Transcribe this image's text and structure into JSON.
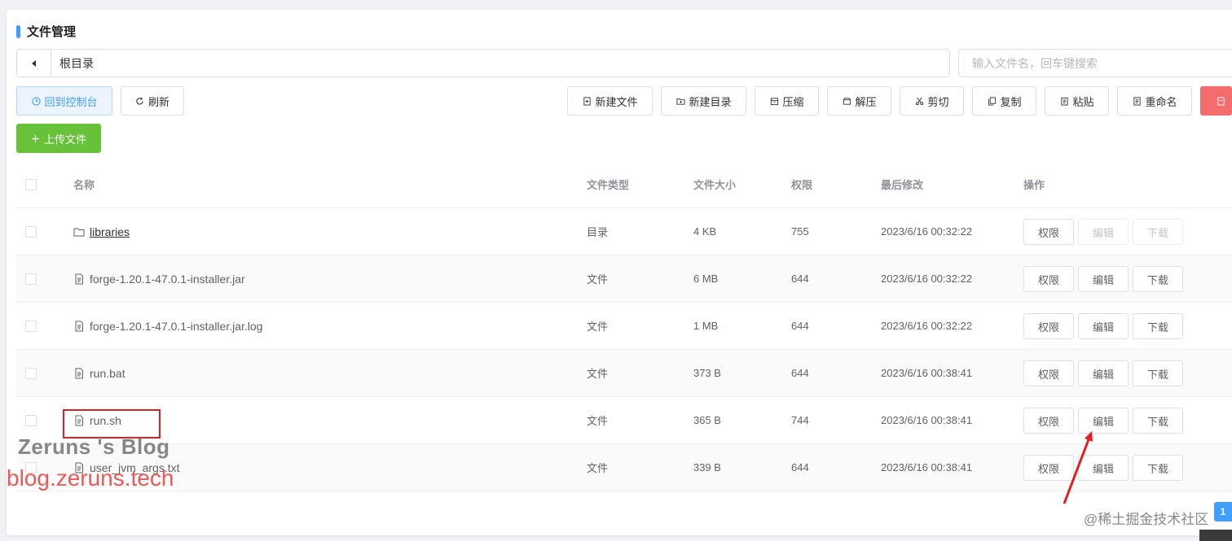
{
  "title": "文件管理",
  "path": {
    "current": "根目录"
  },
  "search": {
    "placeholder": "输入文件名，回车键搜索"
  },
  "toolbar": {
    "back_console": "回到控制台",
    "refresh": "刷新",
    "new_file": "新建文件",
    "new_dir": "新建目录",
    "compress": "压缩",
    "extract": "解压",
    "cut": "剪切",
    "copy": "复制",
    "paste": "粘贴",
    "rename": "重命名",
    "upload": "上传文件"
  },
  "table": {
    "headers": {
      "name": "名称",
      "type": "文件类型",
      "size": "文件大小",
      "perm": "权限",
      "modified": "最后修改",
      "actions": "操作"
    },
    "rows": [
      {
        "name": "libraries",
        "type": "目录",
        "size": "4 KB",
        "perm": "755",
        "modified": "2023/6/16 00:32:22",
        "kind": "folder"
      },
      {
        "name": "forge-1.20.1-47.0.1-installer.jar",
        "type": "文件",
        "size": "6 MB",
        "perm": "644",
        "modified": "2023/6/16 00:32:22",
        "kind": "file"
      },
      {
        "name": "forge-1.20.1-47.0.1-installer.jar.log",
        "type": "文件",
        "size": "1 MB",
        "perm": "644",
        "modified": "2023/6/16 00:32:22",
        "kind": "file"
      },
      {
        "name": "run.bat",
        "type": "文件",
        "size": "373 B",
        "perm": "644",
        "modified": "2023/6/16 00:38:41",
        "kind": "file"
      },
      {
        "name": "run.sh",
        "type": "文件",
        "size": "365 B",
        "perm": "744",
        "modified": "2023/6/16 00:38:41",
        "kind": "file"
      },
      {
        "name": "user_jvm_args.txt",
        "type": "文件",
        "size": "339 B",
        "perm": "644",
        "modified": "2023/6/16 00:38:41",
        "kind": "file"
      }
    ],
    "actions": {
      "perm": "权限",
      "edit": "编辑",
      "download": "下载"
    }
  },
  "watermarks": {
    "blog_name": "Zeruns 's Blog",
    "blog_url": "blog.zeruns.tech",
    "community": "@稀土掘金技术社区"
  },
  "badge": "1",
  "colors": {
    "accent": "#409eff",
    "success": "#67c23a",
    "danger": "#f56c6c",
    "highlight": "#e02020"
  }
}
